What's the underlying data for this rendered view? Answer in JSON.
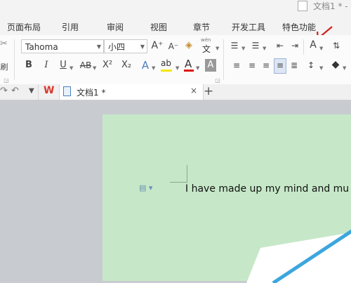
{
  "window": {
    "title": "文档1 * -"
  },
  "menu": {
    "items": [
      "页面布局",
      "引用",
      "审阅",
      "视图",
      "章节",
      "开发工具",
      "特色功能"
    ]
  },
  "ribbon": {
    "font_name": "Tahoma",
    "font_size": "小四",
    "grow_font": "A⁺",
    "shrink_font": "A⁻",
    "bold": "B",
    "italic": "I",
    "underline": "U",
    "strikethrough": "AB",
    "superscript": "X²",
    "subscript": "X₂",
    "font_color": "A",
    "highlight": "ab",
    "char_shading": "A",
    "format_painter_partial": "刷",
    "pinyin_label": "wén",
    "pinyin_char": "文"
  },
  "tabs": {
    "doc_label": "文档1 *",
    "close": "×",
    "new_tab": "+"
  },
  "document": {
    "text": "I have made up my mind and mu"
  },
  "colors": {
    "page_bg": "#c6e8c8",
    "workspace_bg": "#c8cbd0",
    "arrow": "#d32020",
    "wps_logo": "#d9372b"
  },
  "icons": [
    "red-arrow-icon",
    "wps-logo-icon",
    "document-icon",
    "paragraph-icon"
  ]
}
